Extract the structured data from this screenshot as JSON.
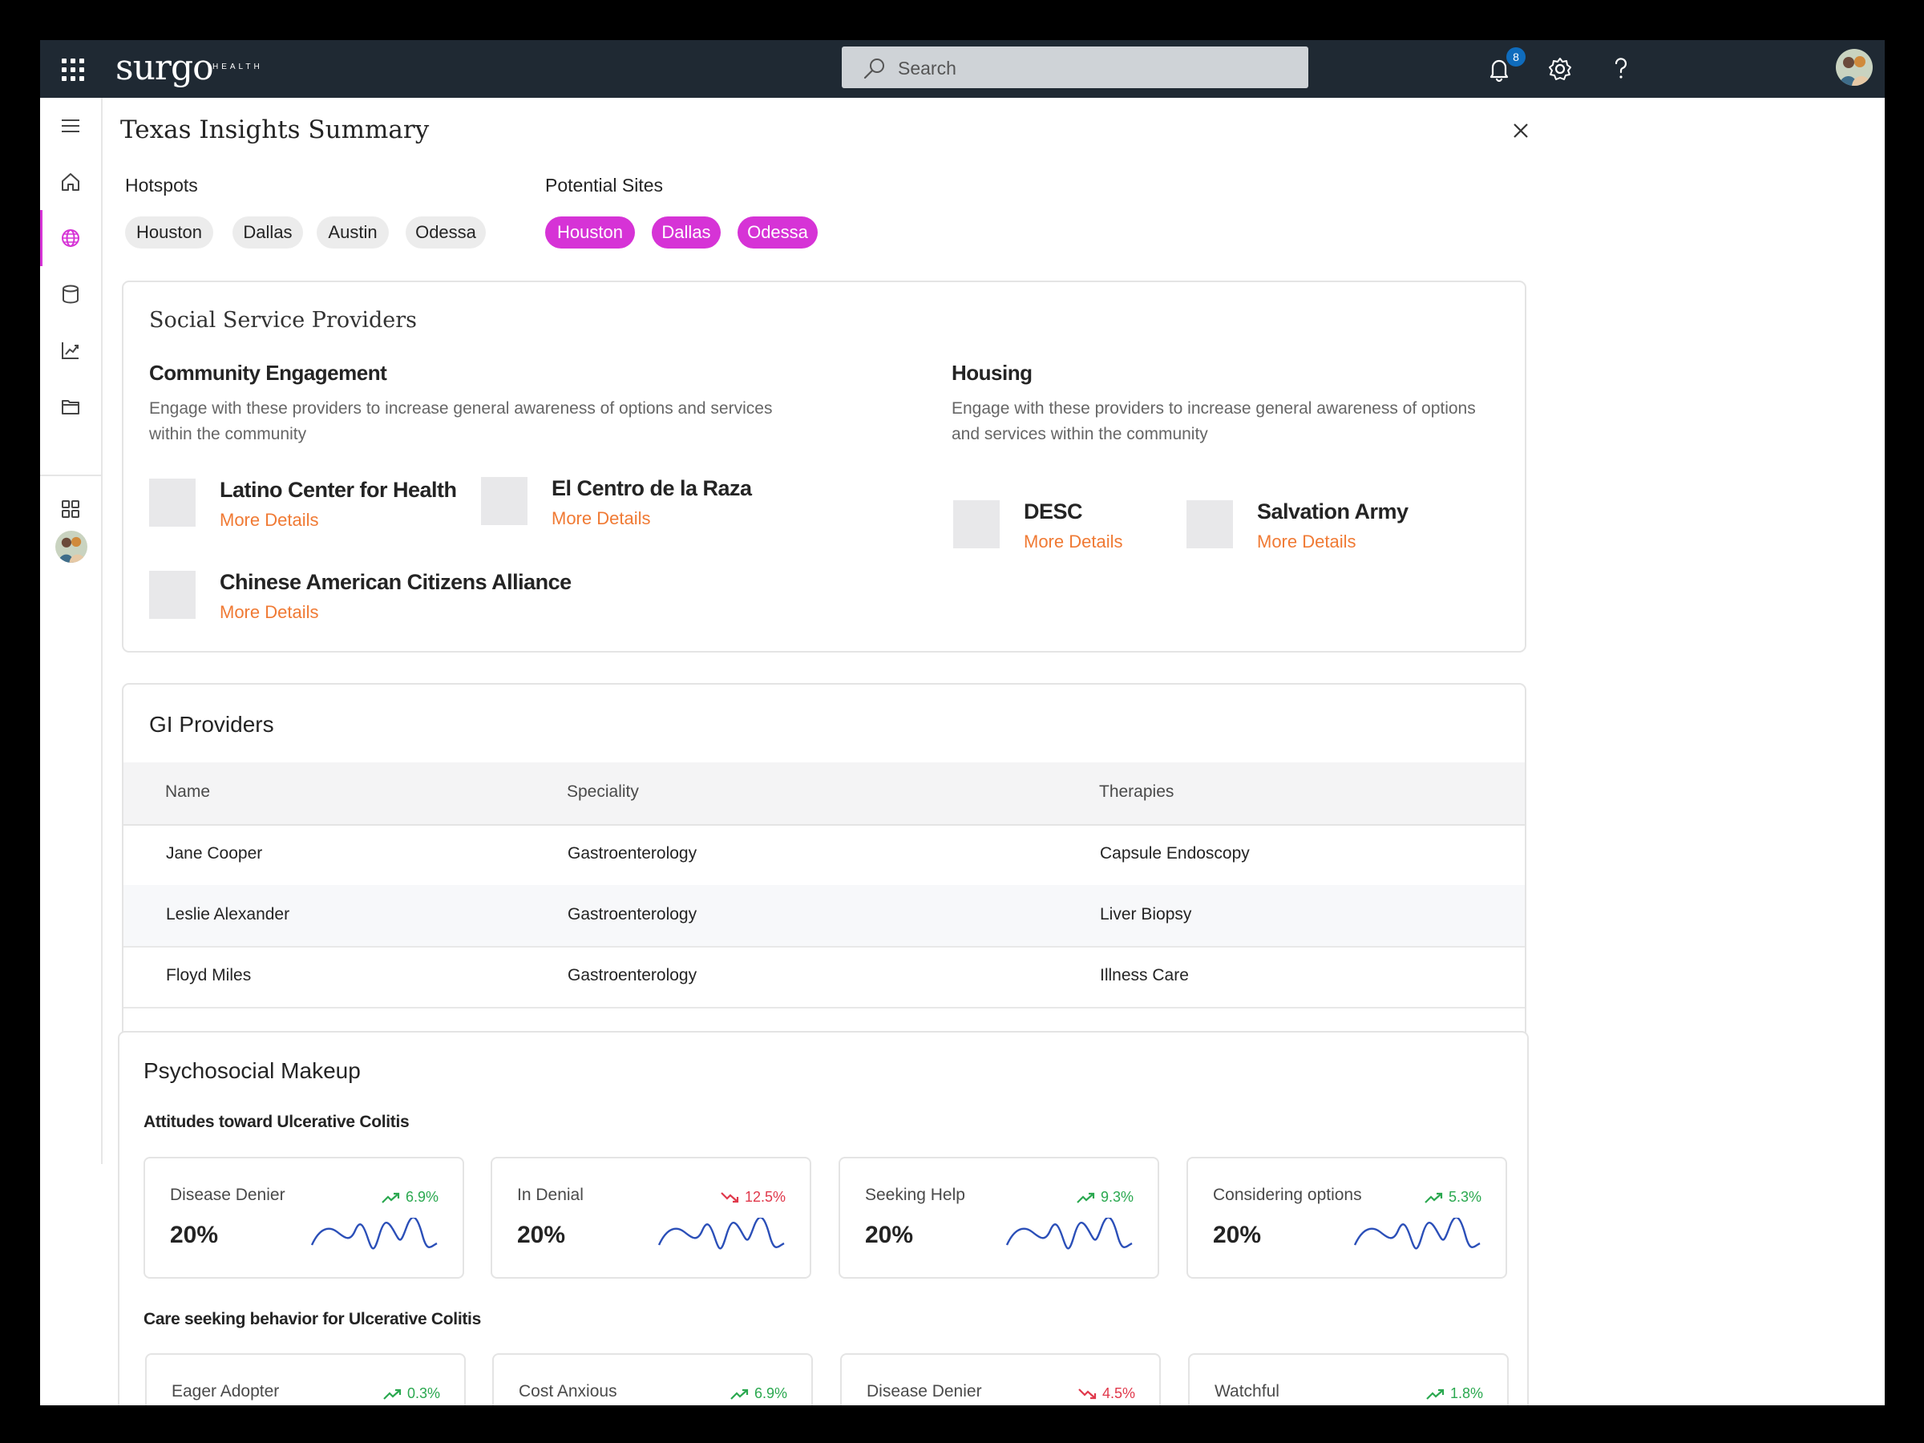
{
  "topbar": {
    "brand": "surgo",
    "brand_sub": "HEALTH",
    "search_placeholder": "Search",
    "notification_count": "8"
  },
  "page": {
    "title": "Texas Insights Summary"
  },
  "hotspots": {
    "label": "Hotspots",
    "items": [
      "Houston",
      "Dallas",
      "Austin",
      "Odessa"
    ]
  },
  "potential_sites": {
    "label": "Potential Sites",
    "items": [
      "Houston",
      "Dallas",
      "Odessa"
    ]
  },
  "social": {
    "title": "Social Service Providers",
    "community": {
      "heading": "Community Engagement",
      "description_1": "Engage with these providers to increase general awareness of options and services",
      "description_2": "within the community",
      "providers": [
        {
          "name": "Latino Center for Health",
          "link": "More Details"
        },
        {
          "name": "El Centro de la Raza",
          "link": "More Details"
        },
        {
          "name": "Chinese American Citizens Alliance",
          "link": "More Details"
        }
      ]
    },
    "housing": {
      "heading": "Housing",
      "description_1": "Engage with these providers to increase general awareness of options",
      "description_2": "and services within the community",
      "providers": [
        {
          "name": "DESC",
          "link": "More Details"
        },
        {
          "name": "Salvation Army",
          "link": "More Details"
        }
      ]
    }
  },
  "gi": {
    "title": "GI Providers",
    "columns": [
      "Name",
      "Speciality",
      "Therapies"
    ],
    "rows": [
      [
        "Jane Cooper",
        "Gastroenterology",
        "Capsule Endoscopy"
      ],
      [
        "Leslie Alexander",
        "Gastroenterology",
        "Liver Biopsy"
      ],
      [
        "Floyd Miles",
        "Gastroenterology",
        "Illness Care"
      ]
    ]
  },
  "psycho": {
    "title": "Psychosocial Makeup",
    "attitudes": {
      "label": "Attitudes toward Ulcerative Colitis",
      "cards": [
        {
          "label": "Disease Denier",
          "value": "20%",
          "trend": "6.9%",
          "direction": "up"
        },
        {
          "label": "In Denial",
          "value": "20%",
          "trend": "12.5%",
          "direction": "down"
        },
        {
          "label": "Seeking Help",
          "value": "20%",
          "trend": "9.3%",
          "direction": "up"
        },
        {
          "label": "Considering options",
          "value": "20%",
          "trend": "5.3%",
          "direction": "up"
        }
      ]
    },
    "care": {
      "label": "Care seeking behavior for Ulcerative Colitis",
      "cards": [
        {
          "label": "Eager Adopter",
          "trend": "0.3%",
          "direction": "up"
        },
        {
          "label": "Cost Anxious",
          "trend": "6.9%",
          "direction": "up"
        },
        {
          "label": "Disease Denier",
          "trend": "4.5%",
          "direction": "down"
        },
        {
          "label": "Watchful",
          "trend": "1.8%",
          "direction": "up"
        }
      ]
    }
  },
  "colors": {
    "accent": "#d633d6",
    "link": "#f07a34",
    "topbar": "#1f2933",
    "up": "#2aa84f",
    "down": "#e0384b",
    "spark": "#2b4fb8"
  }
}
